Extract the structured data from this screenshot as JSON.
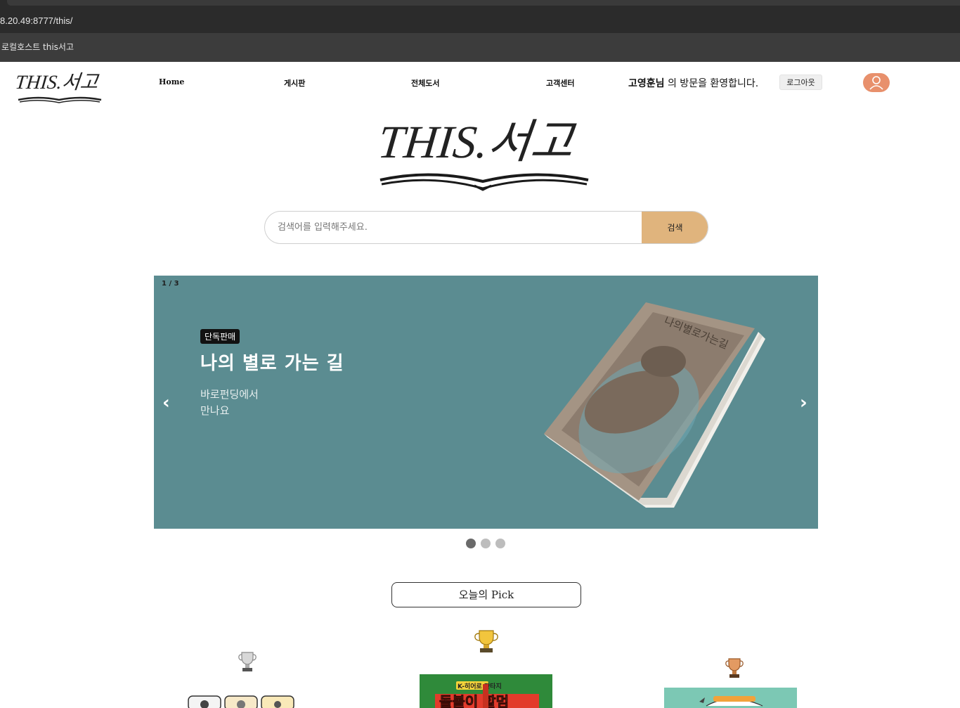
{
  "browser": {
    "url": "8.20.49:8777/this/",
    "bookmark": "로컬호스트 this서고"
  },
  "header": {
    "logo_text": "THIS.서고",
    "nav": [
      "Home",
      "게시판",
      "전체도서",
      "고객센터"
    ],
    "welcome_name": "고영훈님",
    "welcome_rest": " 의 방문을 환영합니다.",
    "logout_label": "로그아웃",
    "avatar_icon": "user-icon",
    "accent_color": "#e8906c"
  },
  "hero": {
    "logo_text": "THIS.서고"
  },
  "search": {
    "placeholder": "검색어를 입력해주세요.",
    "button_label": "검색",
    "button_color": "#e0b47d"
  },
  "carousel": {
    "counter": "1 / 3",
    "badge": "단독판매",
    "title": "나의 별로 가는 길",
    "subtitle_line1": "바로펀딩에서",
    "subtitle_line2": "만나요",
    "prev_icon": "chevron-left-icon",
    "next_icon": "chevron-right-icon",
    "prev_glyph": "‹",
    "next_glyph": "›",
    "background_color": "#5b8c91",
    "book_cover_title": "나의별로가는길",
    "total_slides": 3,
    "active_slide": 1
  },
  "pick": {
    "title": "오늘의 Pick",
    "trophies": [
      "silver-trophy-icon",
      "gold-trophy-icon",
      "bronze-trophy-icon"
    ],
    "center_book_text_top": "K-히어로 판타지",
    "center_book_text_main": "돌볼이 할멈"
  }
}
